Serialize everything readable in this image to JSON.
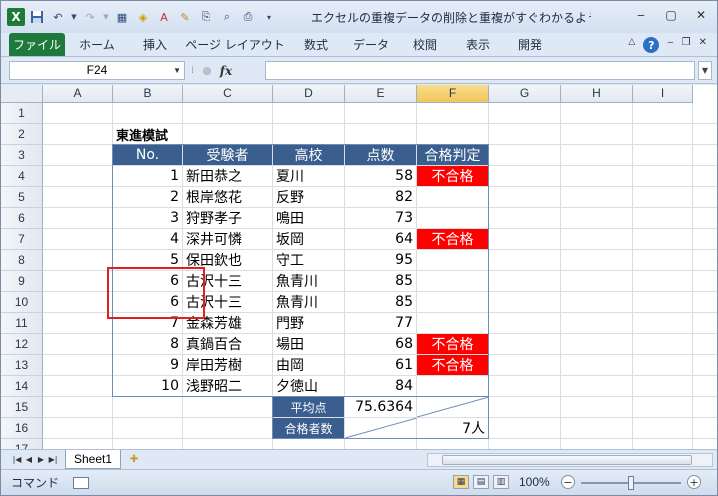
{
  "window": {
    "title": "エクセルの重複データの削除と重複がすぐわかるようにする...",
    "logo": "X",
    "controls": {
      "minimize": "‒",
      "restore": "▢",
      "close": "✕"
    }
  },
  "ribbon": {
    "tabs": [
      "ファイル",
      "ホーム",
      "挿入",
      "ページ レイアウト",
      "数式",
      "データ",
      "校閲",
      "表示",
      "開発"
    ],
    "help": "?"
  },
  "formula_bar": {
    "name_box": "F24",
    "fx": "fx",
    "value": ""
  },
  "grid": {
    "columns": [
      "A",
      "B",
      "C",
      "D",
      "E",
      "F",
      "G",
      "H",
      "I"
    ],
    "selected_column": "F",
    "rows": [
      "1",
      "2",
      "3",
      "4",
      "5",
      "6",
      "7",
      "8",
      "9",
      "10",
      "11",
      "12",
      "13",
      "14",
      "15",
      "16",
      "17"
    ]
  },
  "sheet": {
    "title": "東進模試",
    "headers": {
      "no": "No.",
      "name": "受験者",
      "school": "高校",
      "score": "点数",
      "result": "合格判定"
    },
    "records": [
      {
        "no": "1",
        "name": "新田恭之",
        "school": "夏川",
        "score": "58",
        "result": "不合格"
      },
      {
        "no": "2",
        "name": "根岸悠花",
        "school": "反野",
        "score": "82",
        "result": ""
      },
      {
        "no": "3",
        "name": "狩野孝子",
        "school": "鳴田",
        "score": "73",
        "result": ""
      },
      {
        "no": "4",
        "name": "深井可憐",
        "school": "坂岡",
        "score": "64",
        "result": "不合格"
      },
      {
        "no": "5",
        "name": "保田欽也",
        "school": "守工",
        "score": "95",
        "result": ""
      },
      {
        "no": "6",
        "name": "古沢十三",
        "school": "魚青川",
        "score": "85",
        "result": ""
      },
      {
        "no": "6",
        "name": "古沢十三",
        "school": "魚青川",
        "score": "85",
        "result": ""
      },
      {
        "no": "7",
        "name": "金森芳雄",
        "school": "門野",
        "score": "77",
        "result": ""
      },
      {
        "no": "8",
        "name": "真鍋百合",
        "school": "場田",
        "score": "68",
        "result": "不合格"
      },
      {
        "no": "9",
        "name": "岸田芳樹",
        "school": "由岡",
        "score": "61",
        "result": "不合格"
      },
      {
        "no": "10",
        "name": "浅野昭二",
        "school": "夕徳山",
        "score": "84",
        "result": ""
      }
    ],
    "average_label": "平均点",
    "average_value": "75.6364",
    "passed_label": "合格者数",
    "passed_value": "7人"
  },
  "tabs_bar": {
    "sheet_name": "Sheet1",
    "nav": [
      "|◀",
      "◀",
      "▶",
      "▶|"
    ]
  },
  "status": {
    "mode": "コマンド",
    "zoom": "100%",
    "zoom_out": "−",
    "zoom_in": "+"
  },
  "colors": {
    "header_fill": "#3a5f8f",
    "fail_fill": "#ff0000",
    "highlight_border": "#e02020",
    "file_tab": "#1e7a3c"
  }
}
